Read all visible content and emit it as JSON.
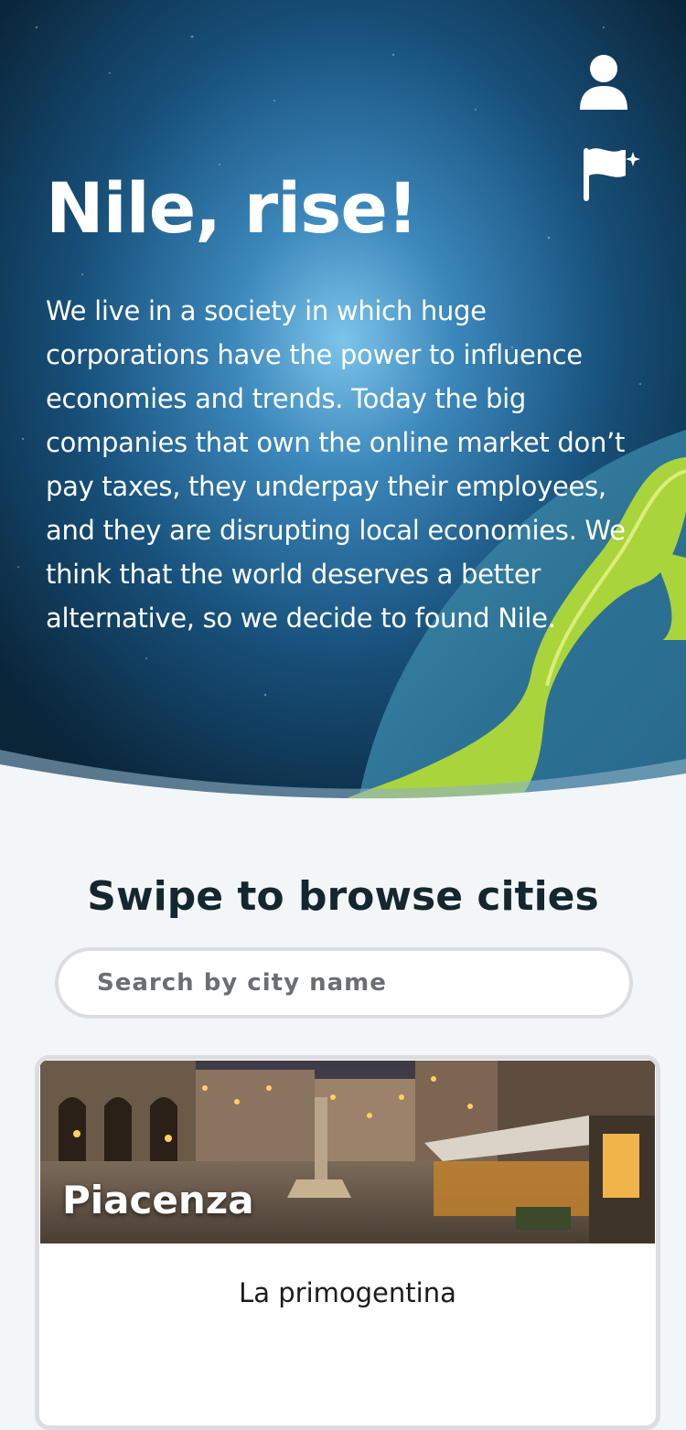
{
  "hero": {
    "title": "Nile, rise!",
    "body": "We live in a society in which huge corporations have the power to influence economies and trends. Today the big companies that own the online market don’t pay taxes, they underpay their employees, and they are disrupting local economies. We think that the world deserves a better alternative, so we decide to found Nile."
  },
  "icons": {
    "account": "user-icon",
    "report": "flag-icon"
  },
  "browse": {
    "title": "Swipe to browse cities",
    "search_placeholder": "Search by city name"
  },
  "cities": [
    {
      "name": "Piacenza",
      "shop": "La primogentina"
    }
  ],
  "colors": {
    "hero_dark": "#0b2a40",
    "hero_glow": "#5aa8d8",
    "land_green": "#a9d43c",
    "page_bg": "#f3f6f9",
    "heading": "#15262e"
  }
}
